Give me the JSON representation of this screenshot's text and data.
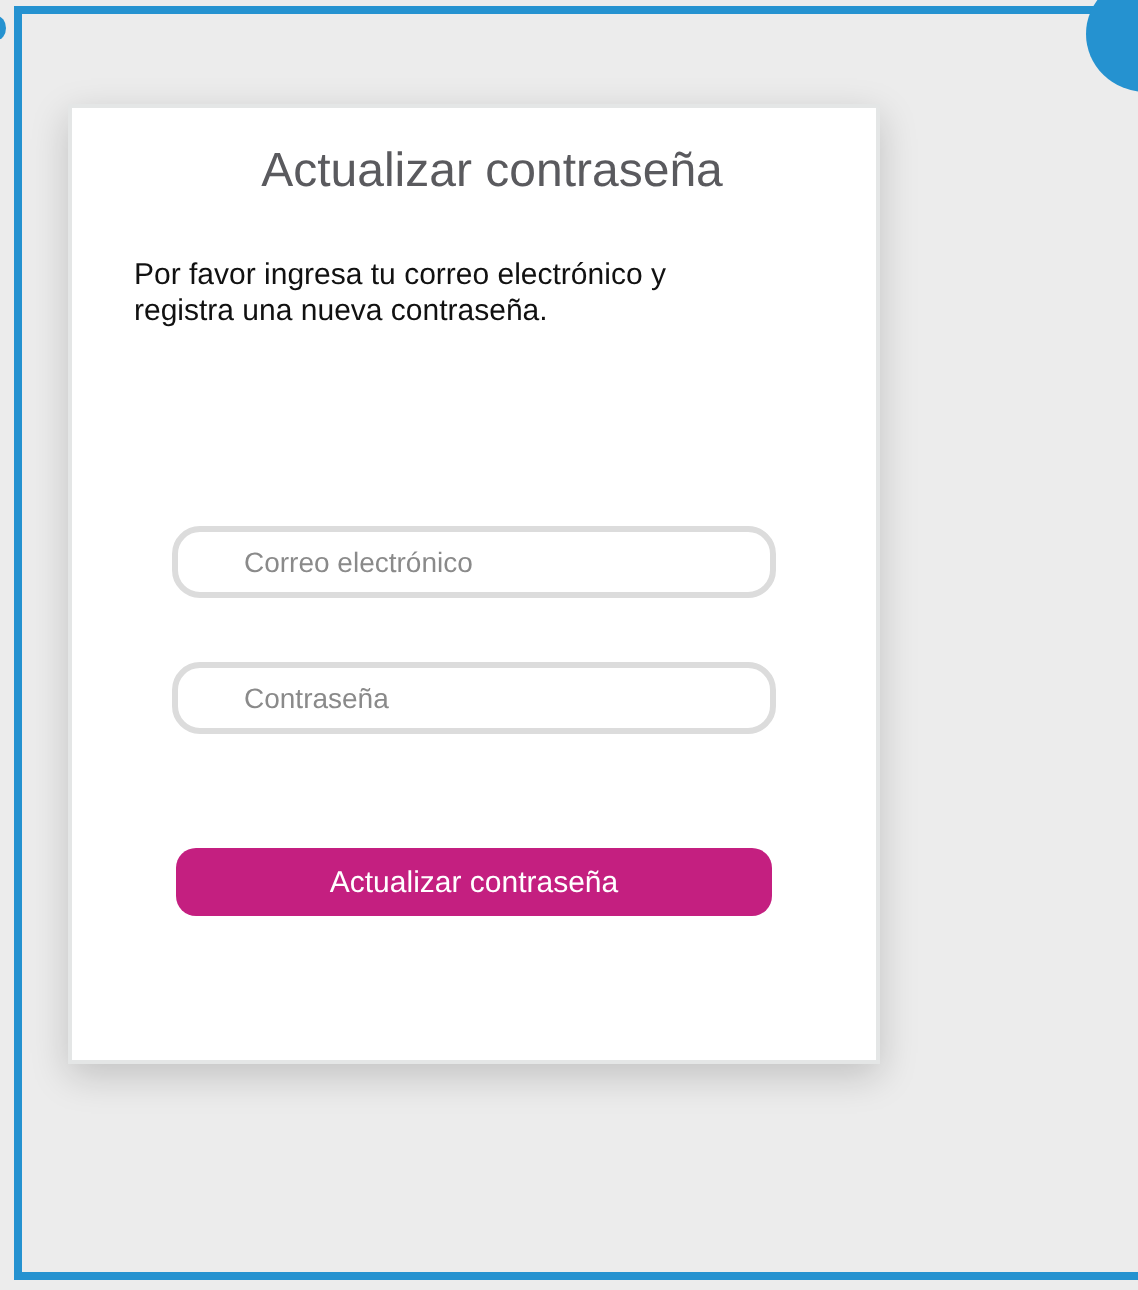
{
  "card": {
    "title": "Actualizar contraseña",
    "instructions": "Por favor ingresa tu correo electrónico y registra una nueva contraseña.",
    "fields": [
      {
        "placeholder": "Correo electrónico"
      },
      {
        "placeholder": "Contraseña"
      }
    ],
    "submit_button": "Actualizar contraseña"
  }
}
